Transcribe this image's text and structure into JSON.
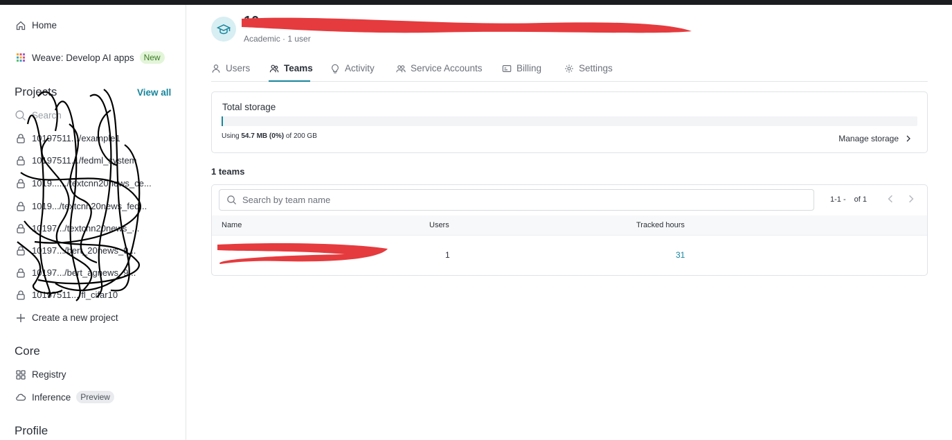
{
  "sidebar": {
    "home_label": "Home",
    "weave_label": "Weave: Develop AI apps",
    "weave_badge": "New",
    "projects_title": "Projects",
    "view_all": "View all",
    "search_placeholder": "Search",
    "projects": [
      "10197511.../example1",
      "10197511.../fedml_system",
      "1019....../textcnn20news_ce...",
      "1019.../textcnn20news_fed...",
      "10197.../textcnn20news_...",
      "10197.../bert_20news_9...",
      "10197.../bert_agnews_9...",
      "10197511.../fl_cifar10"
    ],
    "create_project": "Create a new project",
    "core_title": "Core",
    "registry_label": "Registry",
    "inference_label": "Inference",
    "inference_badge": "Preview",
    "profile_title": "Profile"
  },
  "org": {
    "subtitle": "Academic · 1 user"
  },
  "tabs": [
    {
      "label": "Users",
      "icon": "user-icon"
    },
    {
      "label": "Teams",
      "icon": "users-icon",
      "active": true
    },
    {
      "label": "Activity",
      "icon": "lightbulb-icon"
    },
    {
      "label": "Service Accounts",
      "icon": "service-accounts-icon"
    },
    {
      "label": "Billing",
      "icon": "billing-icon"
    },
    {
      "label": "Settings",
      "icon": "gear-icon"
    }
  ],
  "storage": {
    "title": "Total storage",
    "using_prefix": "Using",
    "used": "54.7 MB (0%)",
    "of_total": "of 200 GB",
    "usage_fraction": 0.0,
    "manage_label": "Manage storage"
  },
  "teams": {
    "count_label": "1 teams",
    "search_placeholder": "Search by team name",
    "pager_range": "1-1 -",
    "pager_of": "of 1",
    "columns": [
      "Name",
      "Users",
      "Tracked hours"
    ],
    "rows": [
      {
        "users": "1",
        "tracked_hours": "31"
      }
    ]
  },
  "colors": {
    "accent": "#16859c",
    "redaction": "#e53b3e"
  }
}
